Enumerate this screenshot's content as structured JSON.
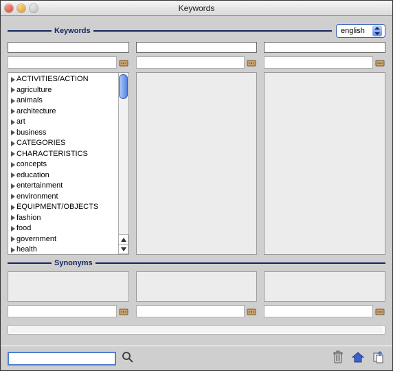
{
  "window": {
    "title": "Keywords"
  },
  "section": {
    "keywords_label": "Keywords",
    "synonyms_label": "Synonyms"
  },
  "language": {
    "selected": "english"
  },
  "columns": {
    "left": {
      "header_value": "",
      "filter_value": "",
      "items": [
        "ACTIVITIES/ACTION",
        "agriculture",
        "animals",
        "architecture",
        "art",
        "business",
        "CATEGORIES",
        "CHARACTERISTICS",
        "concepts",
        "education",
        "entertainment",
        "environment",
        "EQUIPMENT/OBJECTS",
        "fashion",
        "food",
        "government",
        "health"
      ]
    },
    "middle": {
      "header_value": "",
      "filter_value": ""
    },
    "right": {
      "header_value": "",
      "filter_value": ""
    }
  },
  "synonyms": {
    "left": {
      "filter_value": ""
    },
    "middle": {
      "filter_value": ""
    },
    "right": {
      "filter_value": ""
    }
  },
  "search": {
    "value": ""
  }
}
